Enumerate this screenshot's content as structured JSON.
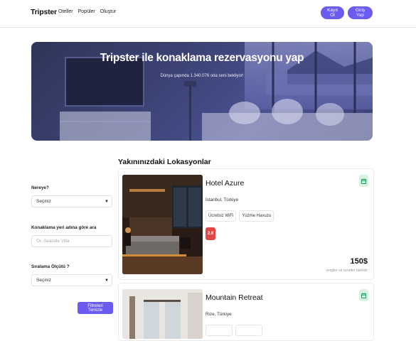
{
  "header": {
    "brand": "Tripster",
    "nav": [
      "Oteller",
      "Popüler",
      "Oluştur"
    ],
    "register_label": "Kayıt Ol",
    "login_label": "Giriş Yap"
  },
  "hero": {
    "title": "Tripster ile konaklama rezervasyonu yap",
    "subtitle": "Dünya çapında 1.340.076 oda seni bekliyor!"
  },
  "section_title": "Yakınınızdaki Lokasyonlar",
  "filters": {
    "destination_label": "Nereye?",
    "destination_value": "Seçiniz",
    "name_label": "Konaklama yeri adına göre ara",
    "name_placeholder": "Ör. Seaside Villa",
    "sort_label": "Sıralama Ölçütü ?",
    "sort_value": "Seçiniz",
    "clear_label": "Filtreleri Temizle"
  },
  "listings": [
    {
      "name": "Hotel Azure",
      "location": "İstanbul, Türkiye",
      "tags": [
        "Ücretsiz WiFi",
        "Yüzme Havuzu"
      ],
      "rating": "2.8",
      "price": "150$",
      "price_note": "vergiler ve ücretler dahildir"
    },
    {
      "name": "Mountain Retreat",
      "location": "Rize, Türkiye"
    }
  ],
  "colors": {
    "accent": "#6a5cf0",
    "rating": "#e04848",
    "calendar_bg": "#d9f3e2",
    "calendar_icon": "#1f9d55"
  }
}
